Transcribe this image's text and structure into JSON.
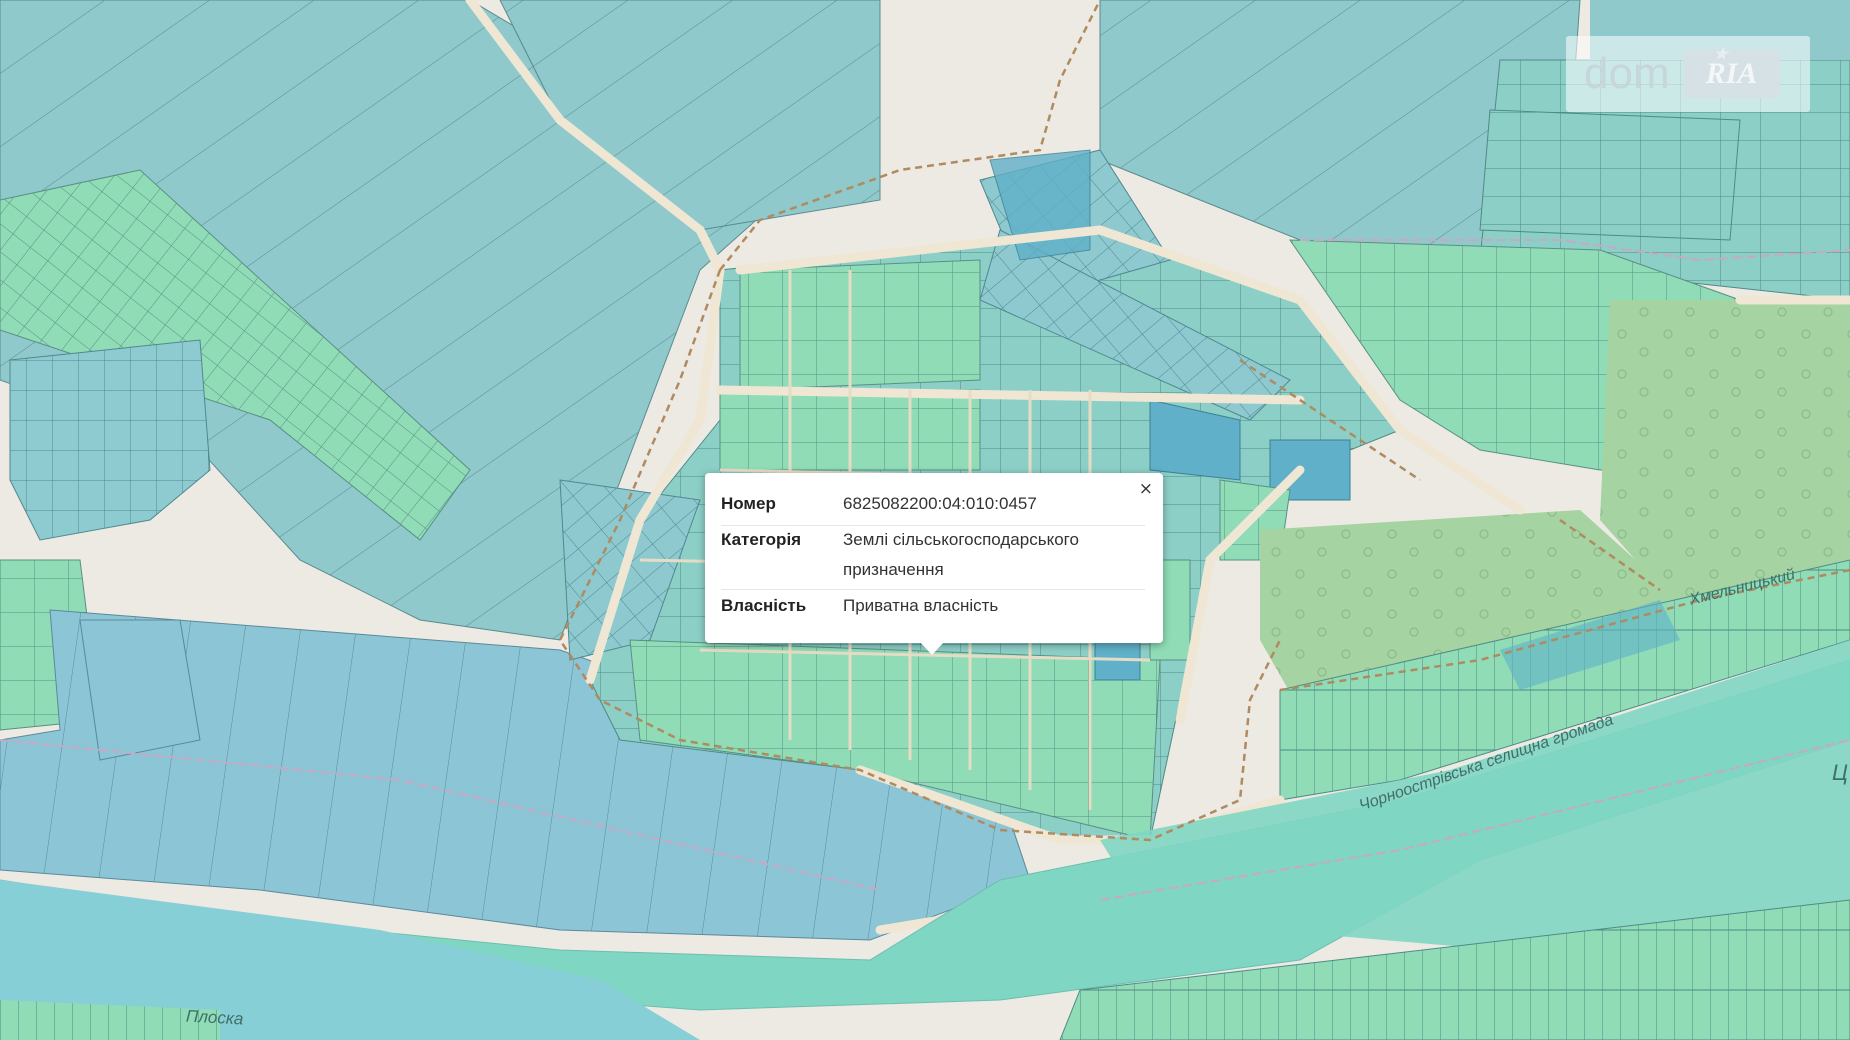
{
  "map": {
    "labels": {
      "river": "Плоска",
      "community": "Чорноострівська селищна громада",
      "city": "Хмельницький",
      "edge": "Ц"
    }
  },
  "logo": {
    "text_dom": "dom",
    "text_ria": "RIA"
  },
  "popup": {
    "close": "×",
    "rows": [
      {
        "key": "Номер",
        "value": "6825082200:04:010:0457"
      },
      {
        "key": "Категорія",
        "value": "Землі сільськогосподарського призначення"
      },
      {
        "key": "Власність",
        "value": "Приватна власність"
      }
    ]
  },
  "colors": {
    "parcel_teal": "#8fc9cc",
    "parcel_green": "#8fdcb6",
    "parcel_blue": "#8cc5d6",
    "parcel_dark": "#5fb0c8",
    "forest": "#a6d3a2",
    "river": "#7fd6c2",
    "boundary": "#b08a60"
  }
}
